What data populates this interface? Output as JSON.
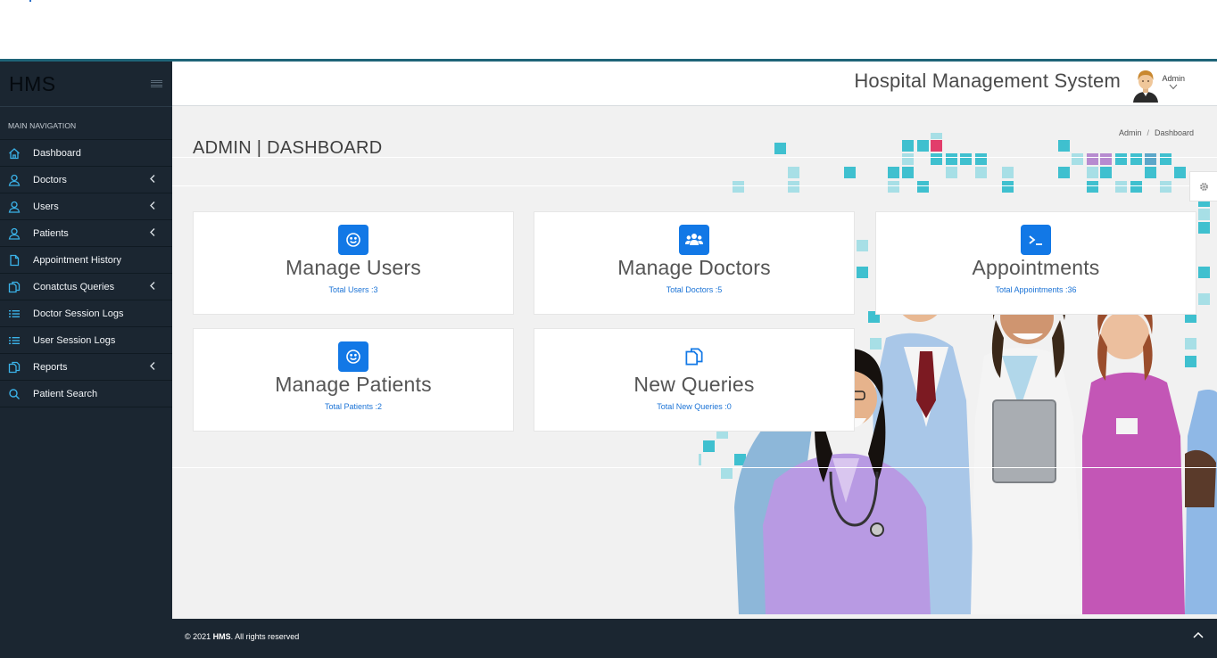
{
  "sidebar": {
    "brand": "HMS",
    "nav_title": "MAIN NAVIGATION",
    "items": [
      {
        "label": "Dashboard",
        "icon": "home-icon",
        "has_submenu": false
      },
      {
        "label": "Doctors",
        "icon": "user-icon",
        "has_submenu": true
      },
      {
        "label": "Users",
        "icon": "user-icon",
        "has_submenu": true
      },
      {
        "label": "Patients",
        "icon": "user-icon",
        "has_submenu": true
      },
      {
        "label": "Appointment History",
        "icon": "file-icon",
        "has_submenu": false
      },
      {
        "label": "Conatctus Queries",
        "icon": "files-icon",
        "has_submenu": true
      },
      {
        "label": "Doctor Session Logs",
        "icon": "list-icon",
        "has_submenu": false
      },
      {
        "label": "User Session Logs",
        "icon": "list-icon",
        "has_submenu": false
      },
      {
        "label": "Reports",
        "icon": "files-icon",
        "has_submenu": true
      },
      {
        "label": "Patient Search",
        "icon": "search-icon",
        "has_submenu": false
      }
    ]
  },
  "header": {
    "title": "Hospital Management System",
    "user": "Admin"
  },
  "main": {
    "page_title": "ADMIN | DASHBOARD",
    "breadcrumb": [
      "Admin",
      "Dashboard"
    ],
    "cards": [
      {
        "title": "Manage Users",
        "subtitle": "Total Users :3",
        "icon": "smile-icon"
      },
      {
        "title": "Manage Doctors",
        "subtitle": "Total Doctors :5",
        "icon": "users-icon"
      },
      {
        "title": "Appointments",
        "subtitle": "Total Appointments :36",
        "icon": "terminal-icon"
      },
      {
        "title": "Manage Patients",
        "subtitle": "Total Patients :2",
        "icon": "smile-icon"
      },
      {
        "title": "New Queries",
        "subtitle": "Total New Queries :0",
        "icon": "files-icon"
      }
    ]
  },
  "footer": {
    "copyright_prefix": "© 2021",
    "brand": "HMS",
    "copyright_suffix": ". All rights reserved"
  },
  "colors": {
    "sidebar_bg": "#1b2631",
    "accent_blue": "#1278e6",
    "link_blue": "#1b73d6",
    "top_border": "#1e6478",
    "mosaic_teal": "#3fc0cf"
  }
}
